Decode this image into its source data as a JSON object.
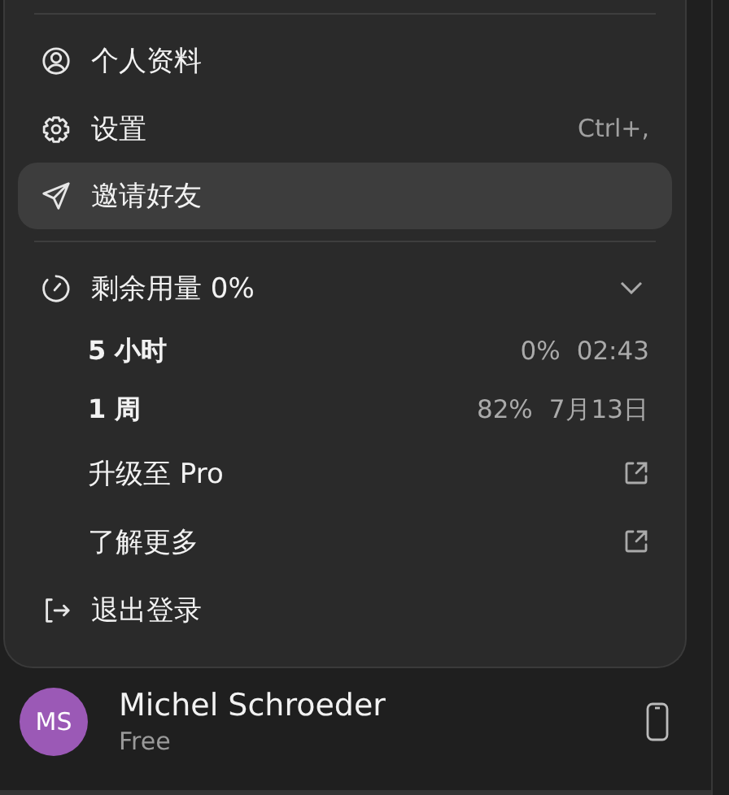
{
  "menu": {
    "items": [
      {
        "kind": "profile",
        "label": "个人资料",
        "selected": false
      },
      {
        "kind": "settings",
        "label": "设置",
        "shortcut": "Ctrl+,",
        "selected": false
      },
      {
        "kind": "invite",
        "label": "邀请好友",
        "selected": true
      }
    ],
    "usage": {
      "label": "剩余用量 0%",
      "expanded": true,
      "rows": [
        {
          "label": "5 小时",
          "percent": "0%",
          "reset": "02:43"
        },
        {
          "label": "1 周",
          "percent": "82%",
          "reset": "7月13日"
        }
      ]
    },
    "links": [
      {
        "label": "升级至 Pro"
      },
      {
        "label": "了解更多"
      }
    ],
    "logout": {
      "label": "退出登录"
    }
  },
  "user": {
    "initials": "MS",
    "name": "Michel Schroeder",
    "plan": "Free"
  }
}
